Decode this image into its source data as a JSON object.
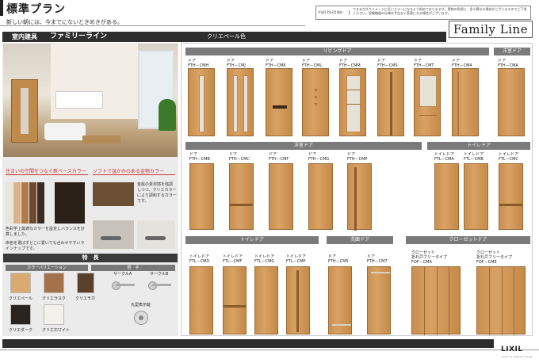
{
  "header": {
    "title": "標準プラン",
    "tagline": "新しい朝には、今までにないときめきがある。",
    "note_code": "平成23年2月現在",
    "note_text": "できるかぎりイメージに近いカラーになるよう努めておりますが、実物の色調と、多少異なる場合がございますのでご了承ください。設備機器の仕様は予告なく変更になる場合がございます。",
    "brand": "Family Line"
  },
  "bar": {
    "category": "室内建具",
    "line": "ファミリーライン",
    "color": "クリエペール色"
  },
  "left": {
    "feature1_head": "住まいの空間をつなぐ新ベースカラー",
    "feature2_head": "ソフトで温かみのある金物カラー",
    "feature1_text": "色彩学上最適なカラーを設定しバランスを計算しました。",
    "feature1_text2": "床色を選ばずどこに置いても合わせやすいラインナップです。",
    "feature2_text": "金属の素材感を強調しつつ、クリエカラーにより調和するカラーです。",
    "features_label": "特　長",
    "color_variation_label": "カラーバリエーション",
    "hardware_label": "把　手",
    "swatches": [
      {
        "name": "クリエペール",
        "color": "#d9ab72"
      },
      {
        "name": "クリエラスク",
        "color": "#a3724a"
      },
      {
        "name": "クリエモカ",
        "color": "#5a3f2b"
      },
      {
        "name": "クリエダーク",
        "color": "#2a2420"
      },
      {
        "name": "クリエホワイト",
        "color": "#f3f1ec"
      }
    ],
    "hardware": [
      {
        "name": "サークルA"
      },
      {
        "name": "サークルB"
      },
      {
        "name": "丸型表示錠"
      }
    ],
    "textures": [
      "#e9e5dc",
      "#d8b488",
      "#b07a4a",
      "#6b4a30",
      "#3b2b20"
    ]
  },
  "doors": {
    "living_head": "リビングドア",
    "closet_head1": "洋室ドア",
    "yoshitsu_head": "洋室ドア",
    "toilet_head1": "トイレドア",
    "toilet_head2": "トイレドア",
    "washroom_head": "洗面ドア",
    "closet_head2": "クローゼットドア",
    "row1": [
      {
        "type": "ドア",
        "code": "FTH－CMH"
      },
      {
        "type": "ドア",
        "code": "FTH－CMJ"
      },
      {
        "type": "ドア",
        "code": "FTH－CMK"
      },
      {
        "type": "ドア",
        "code": "FTH－CML"
      },
      {
        "type": "ドア",
        "code": "FTH－CMM"
      },
      {
        "type": "ドア",
        "code": "FTH－CMS"
      },
      {
        "type": "ドア",
        "code": "FTH－CMT"
      },
      {
        "type": "ドア",
        "code": "FTH－CM4"
      },
      {
        "type": "ドア",
        "code": "FTH－CMA"
      }
    ],
    "row2": [
      {
        "type": "ドア",
        "code": "FTH－CMB"
      },
      {
        "type": "ドア",
        "code": "FTH－CMC"
      },
      {
        "type": "ドア",
        "code": "FTH－CMF"
      },
      {
        "type": "ドア",
        "code": "FTH－CMG"
      },
      {
        "type": "ドア",
        "code": "FTH－CMP"
      },
      {
        "type": "トイレドア",
        "code": "FTL－CMA"
      },
      {
        "type": "トイレドア",
        "code": "FTL－CMB"
      },
      {
        "type": "トイレドア",
        "code": "FTL－CMC"
      }
    ],
    "row3": [
      {
        "type": "トイレドア",
        "code": "FTL－CMD"
      },
      {
        "type": "トイレドア",
        "code": "FTL－CMF"
      },
      {
        "type": "トイレドア",
        "code": "FTL－CMG"
      },
      {
        "type": "トイレドア",
        "code": "FTL－CMP"
      },
      {
        "type": "ドア",
        "code": "FTH－CM5"
      },
      {
        "type": "ドア",
        "code": "FTH－CM7"
      }
    ],
    "closets": [
      {
        "line1": "クローゼット",
        "line2": "折れ戸フリータイプ",
        "code": "FOF－CMA"
      },
      {
        "line1": "クローゼット",
        "line2": "折れ戸フリータイプ",
        "code": "FOF－CME"
      }
    ]
  },
  "footer": {
    "logo": "LIXIL",
    "logo_sub": "Link to Good Living"
  }
}
